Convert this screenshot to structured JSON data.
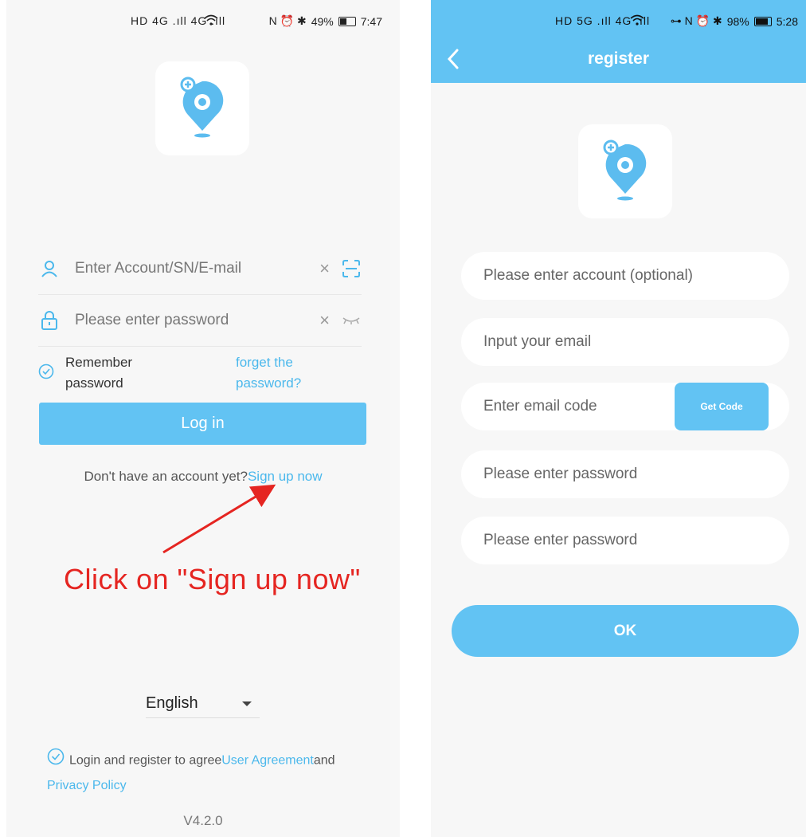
{
  "login": {
    "status": {
      "signal": "HD 4G .ıll 4G .ıll",
      "indicators": "N ⏰ ✱",
      "battery": "49%",
      "battery_level": 0.49,
      "time": "7:47"
    },
    "account_placeholder": "Enter Account/SN/E-mail",
    "password_placeholder": "Please enter password",
    "clear_symbol": "×",
    "remember_label": "Remember password",
    "forget_label": "forget the password?",
    "login_button": "Log in",
    "signup_prompt": "Don't have an account yet?",
    "signup_link": "Sign up now",
    "annotation": "Click on \"Sign up now\"",
    "language": "English",
    "agree_text": "Login and register to agree",
    "user_agreement": "User Agreement",
    "and_text": "and",
    "privacy_policy": "Privacy Policy",
    "version": "V4.2.0"
  },
  "register": {
    "status": {
      "signal": "HD 5G .ıll 4G .ıll",
      "indicators": "⊶ N ⏰ ✱",
      "battery": "98%",
      "battery_level": 0.98,
      "time": "5:28"
    },
    "title": "register",
    "account_placeholder": "Please enter account (optional)",
    "email_placeholder": "Input your email",
    "code_placeholder": "Enter email code",
    "get_code": "Get Code",
    "password_placeholder": "Please enter password",
    "confirm_placeholder": "Please enter password",
    "ok_button": "OK"
  },
  "colors": {
    "accent": "#62c3f3",
    "link": "#4bb8ec",
    "annotation": "#e52521",
    "logo": "#5cbcef"
  },
  "icons": [
    "user-icon",
    "lock-icon",
    "scan-icon",
    "eye-closed-icon",
    "check-circle-icon",
    "back-arrow-icon",
    "wifi-icon",
    "battery-icon",
    "app-logo-icon"
  ]
}
